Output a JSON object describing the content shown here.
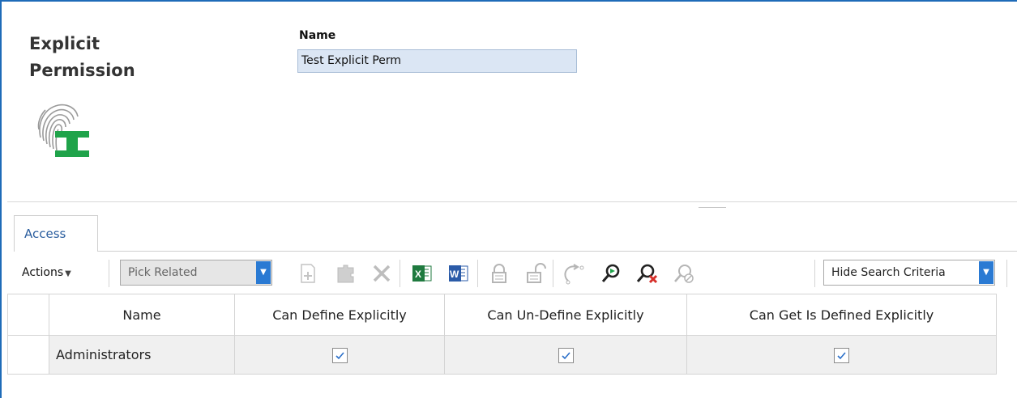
{
  "header": {
    "title": "Explicit Permission",
    "name_label": "Name",
    "name_value": "Test Explicit Perm"
  },
  "tabs": [
    {
      "label": "Access"
    }
  ],
  "toolbar": {
    "actions_label": "Actions",
    "pick_related_label": "Pick Related",
    "hide_search_label": "Hide Search Criteria",
    "icons": [
      "add-icon",
      "puzzle-icon",
      "delete-icon",
      "excel-icon",
      "word-icon",
      "lock-icon",
      "unlock-icon",
      "refresh-icon",
      "search-icon",
      "clear-search-icon",
      "search-disabled-icon"
    ]
  },
  "grid": {
    "columns": [
      "Name",
      "Can Define Explicitly",
      "Can Un-Define Explicitly",
      "Can Get Is Defined Explicitly"
    ],
    "rows": [
      {
        "name": "Administrators",
        "can_define": true,
        "can_undefine": true,
        "can_get": true
      }
    ]
  },
  "colors": {
    "accent": "#1e6bb8",
    "dropdown_blue": "#2a7ad3",
    "input_bg": "#dbe6f4",
    "icon_green": "#1fa34a"
  }
}
